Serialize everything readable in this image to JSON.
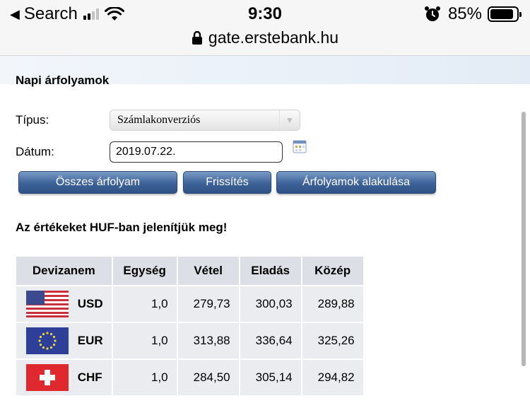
{
  "status_bar": {
    "back_label": "Search",
    "time": "9:30",
    "battery": "85%",
    "url": "gate.erstebank.hu"
  },
  "page": {
    "heading": "Napi árfolyamok",
    "type_label": "Típus:",
    "type_value": "Számlakonverziós",
    "date_label": "Dátum:",
    "date_value": "2019.07.22.",
    "buttons": {
      "all_rates": "Összes árfolyam",
      "refresh": "Frissítés",
      "trend": "Árfolyamok alakulása"
    },
    "note": "Az értékeket HUF-ban jelenítjük meg!"
  },
  "table": {
    "headers": [
      "Devizanem",
      "Egység",
      "Vétel",
      "Eladás",
      "Közép"
    ],
    "rows": [
      {
        "code": "USD",
        "flag": "us-flag-icon",
        "unit": "1,0",
        "buy": "279,73",
        "sell": "300,03",
        "mid": "289,88"
      },
      {
        "code": "EUR",
        "flag": "eu-flag-icon",
        "unit": "1,0",
        "buy": "313,88",
        "sell": "336,64",
        "mid": "325,26"
      },
      {
        "code": "CHF",
        "flag": "ch-flag-icon",
        "unit": "1,0",
        "buy": "284,50",
        "sell": "305,14",
        "mid": "294,82"
      }
    ]
  },
  "colors": {
    "button_top": "#7a9bc7",
    "button_bottom": "#2f5286",
    "header_cell": "#dcdfe5",
    "body_cell": "#eaecef"
  }
}
